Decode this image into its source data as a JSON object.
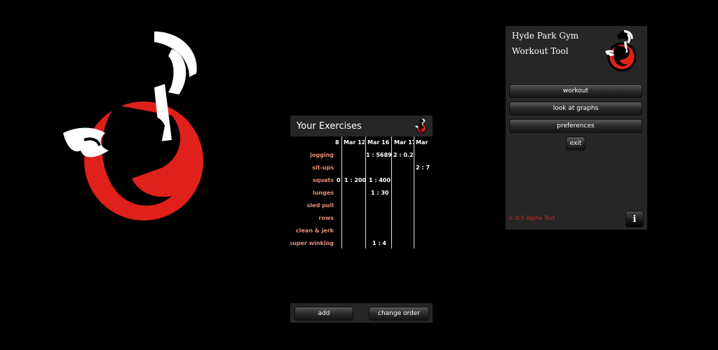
{
  "colors": {
    "accent_red": "#e0201b",
    "label_salmon": "#e8907a",
    "version_red": "#d02a20",
    "panel": "#262626"
  },
  "exercises_screen": {
    "title": "Your Exercises",
    "logo_icon": "gym-logo-icon",
    "columns": [
      "8",
      "Mar 12",
      "Mar 16",
      "Mar 17",
      "Mar"
    ],
    "rows": [
      {
        "name": "jogging",
        "cells": [
          "",
          "",
          "1 : 5689",
          "2 : 0.2",
          ""
        ]
      },
      {
        "name": "sit-ups",
        "cells": [
          "",
          "",
          "",
          "",
          "2 : 7"
        ]
      },
      {
        "name": "squats",
        "cells": [
          "0",
          "1 : 200",
          "1 : 400",
          "",
          ""
        ]
      },
      {
        "name": "lunges",
        "cells": [
          "",
          "",
          "1 : 30",
          "",
          ""
        ]
      },
      {
        "name": "sled pull",
        "cells": [
          "",
          "",
          "",
          "",
          ""
        ]
      },
      {
        "name": "rows",
        "cells": [
          "",
          "",
          "",
          "",
          ""
        ]
      },
      {
        "name": "clean & jerk",
        "cells": [
          "",
          "",
          "",
          "",
          ""
        ]
      },
      {
        "name": "super winking",
        "cells": [
          "",
          "",
          "1 : 4",
          "",
          ""
        ]
      }
    ],
    "add_label": "add",
    "change_order_label": "change order"
  },
  "home_screen": {
    "title_line1": "Hyde Park Gym",
    "title_line2": "Workout Tool",
    "buttons": [
      "workout",
      "look at graphs",
      "preferences"
    ],
    "exit_label": "exit",
    "version": "v. 0.5 Alpha Test",
    "info_label": "i"
  }
}
